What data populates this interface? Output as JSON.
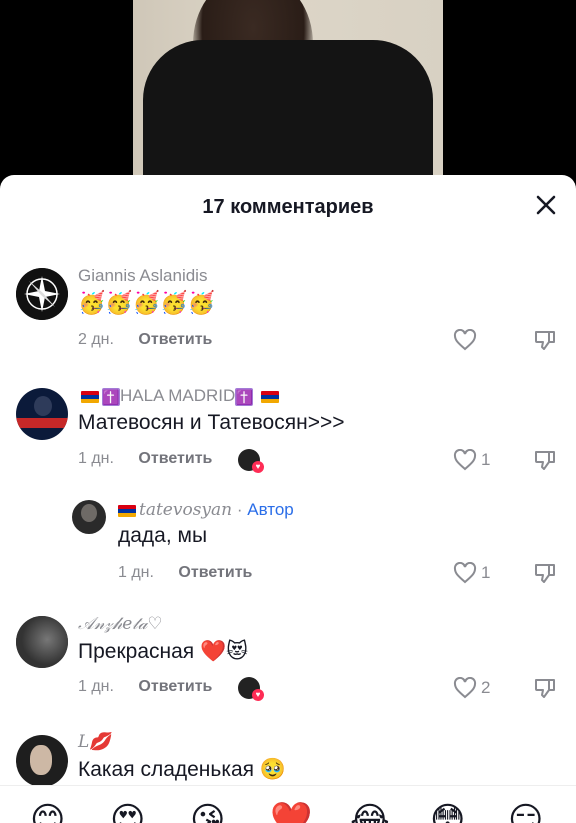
{
  "header": {
    "title": "17 комментариев"
  },
  "comments": [
    {
      "username": "Giannis Aslanidis",
      "text": "🥳🥳🥳🥳🥳",
      "time": "2 дн.",
      "reply_label": "Ответить",
      "likes": ""
    },
    {
      "username_prefix": "✝️",
      "username": "HALA MADRID",
      "username_suffix": "✝️",
      "text": "Матевосян и Татевосян>>>",
      "time": "1 дн.",
      "reply_label": "Ответить",
      "likes": "1"
    },
    {
      "username": "tatevosyan",
      "author_separator": " · ",
      "author_label": "Автор",
      "text": "дада, мы",
      "time": "1 дн.",
      "reply_label": "Ответить",
      "likes": "1"
    },
    {
      "username": "𝒜𝓃𝓏𝒽𝑒𝓉𝒶♡",
      "text": "Прекрасная ❤️😻",
      "time": "1 дн.",
      "reply_label": "Ответить",
      "likes": "2"
    },
    {
      "username": "𝐿💋",
      "text": "Какая сладенькая 🥹"
    }
  ],
  "emoji_bar": [
    "😊",
    "😍",
    "😘",
    "❤️",
    "😂",
    "😳",
    "😏"
  ],
  "icons": {
    "close": "close-icon",
    "like": "heart-outline-icon",
    "dislike": "thumbs-down-icon"
  }
}
